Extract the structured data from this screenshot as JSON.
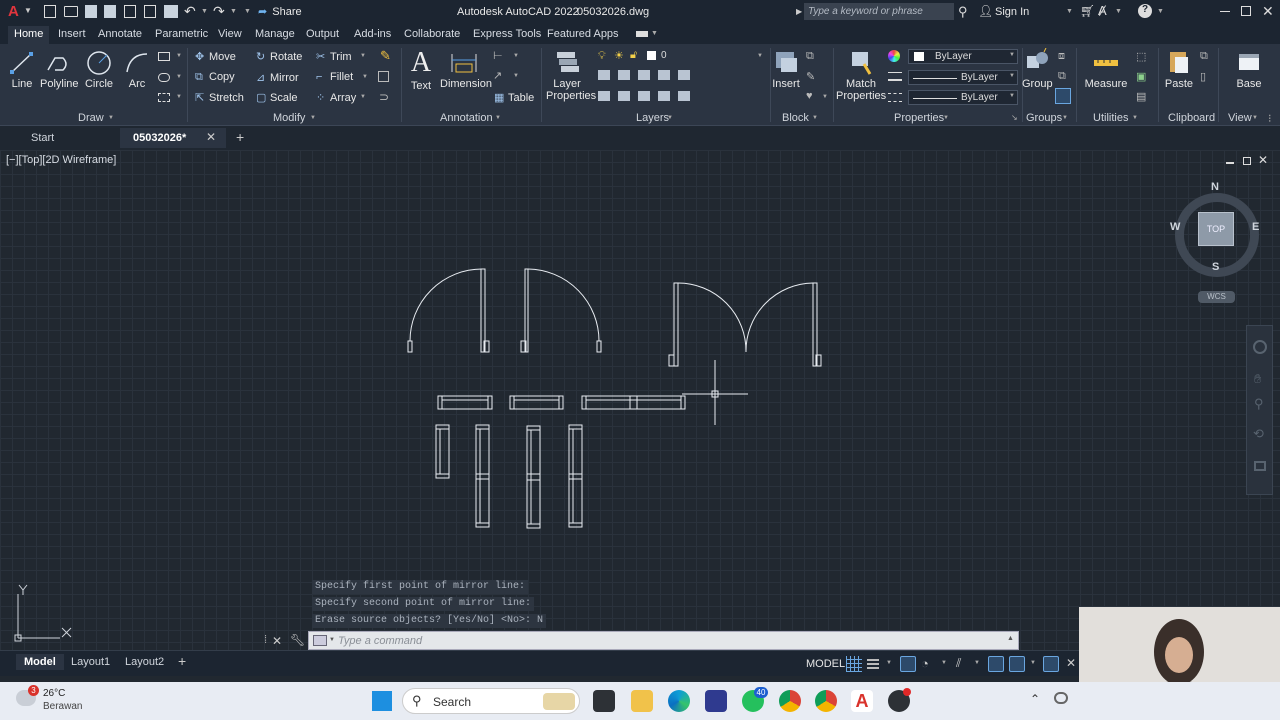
{
  "titlebar": {
    "app_title": "Autodesk AutoCAD 2022",
    "file_name": "05032026.dwg",
    "share_label": "Share",
    "search_placeholder": "Type a keyword or phrase",
    "signin_label": "Sign In"
  },
  "ribbon_tabs": [
    "Home",
    "Insert",
    "Annotate",
    "Parametric",
    "View",
    "Manage",
    "Output",
    "Add-ins",
    "Collaborate",
    "Express Tools",
    "Featured Apps"
  ],
  "ribbon": {
    "draw": {
      "line": "Line",
      "polyline": "Polyline",
      "circle": "Circle",
      "arc": "Arc",
      "panel": "Draw"
    },
    "modify": {
      "move": "Move",
      "rotate": "Rotate",
      "trim": "Trim",
      "copy": "Copy",
      "mirror": "Mirror",
      "fillet": "Fillet",
      "stretch": "Stretch",
      "scale": "Scale",
      "array": "Array",
      "panel": "Modify"
    },
    "annotation": {
      "text": "Text",
      "dimension": "Dimension",
      "table": "Table",
      "panel": "Annotation"
    },
    "layers": {
      "properties": "Layer Properties",
      "current": "0",
      "panel": "Layers"
    },
    "block": {
      "insert": "Insert",
      "panel": "Block"
    },
    "properties": {
      "match": "Match Properties",
      "color": "ByLayer",
      "linetype": "ByLayer",
      "lineweight": "ByLayer",
      "panel": "Properties"
    },
    "groups": {
      "group": "Group",
      "panel": "Groups"
    },
    "utilities": {
      "measure": "Measure",
      "panel": "Utilities"
    },
    "clipboard": {
      "paste": "Paste",
      "panel": "Clipboard"
    },
    "view": {
      "base": "Base",
      "panel": "View"
    }
  },
  "file_tabs": {
    "start": "Start",
    "current": "05032026*"
  },
  "viewport": {
    "label": "[−][Top][2D Wireframe]",
    "viewcube": {
      "top": "TOP",
      "n": "N",
      "s": "S",
      "e": "E",
      "w": "W",
      "wcs": "WCS"
    }
  },
  "command": {
    "history": [
      "Specify first point of mirror line:",
      "Specify second point of mirror line:",
      "Erase source objects? [Yes/No] <No>: N"
    ],
    "placeholder": "Type a command"
  },
  "layout_tabs": [
    "Model",
    "Layout1",
    "Layout2"
  ],
  "status": {
    "model_label": "MODEL"
  },
  "taskbar": {
    "temperature": "26°C",
    "weather": "Berawan",
    "weather_badge": "3",
    "search_label": "Search",
    "whatsapp_badge": "40"
  }
}
